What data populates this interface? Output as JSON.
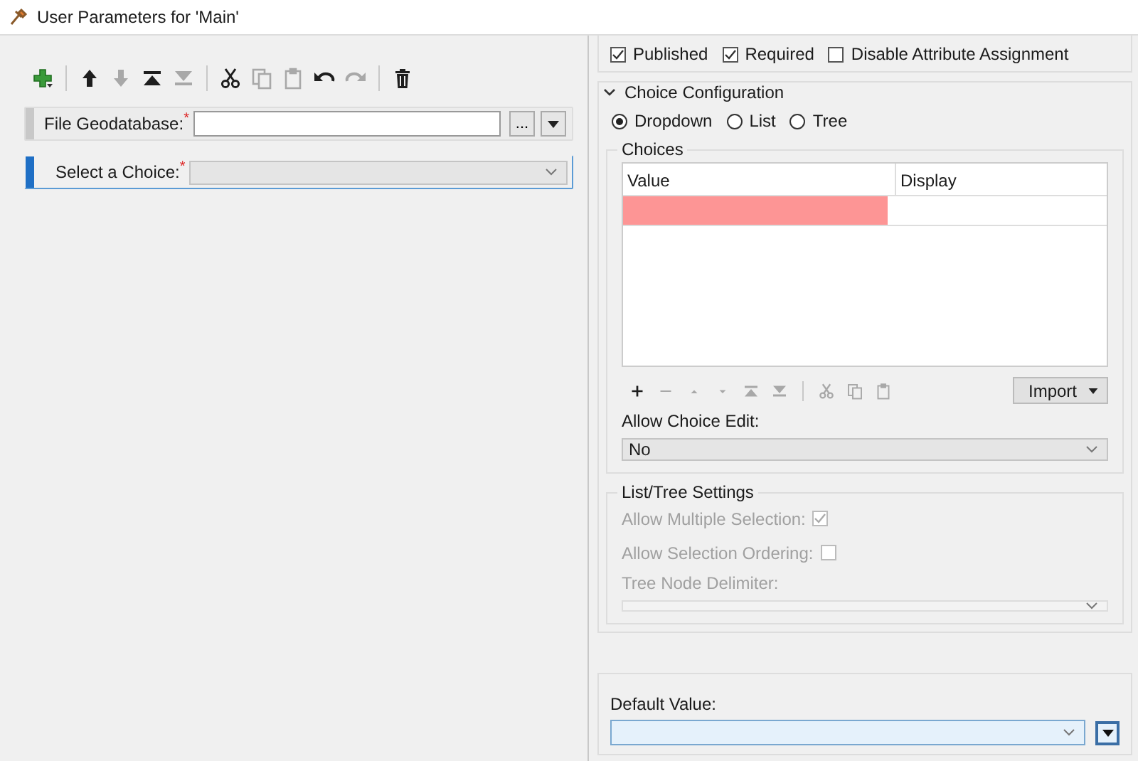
{
  "window": {
    "title": "User Parameters for 'Main'"
  },
  "toolbar": [
    [
      {
        "kind": "add",
        "disabled": false
      }
    ],
    [
      {
        "kind": "up",
        "disabled": false
      },
      {
        "kind": "down",
        "disabled": true
      },
      {
        "kind": "top",
        "disabled": false
      },
      {
        "kind": "bottom",
        "disabled": true
      }
    ],
    [
      {
        "kind": "cut",
        "disabled": false
      },
      {
        "kind": "copy",
        "disabled": true
      },
      {
        "kind": "paste",
        "disabled": true
      },
      {
        "kind": "undo",
        "disabled": false
      },
      {
        "kind": "redo",
        "disabled": true
      }
    ],
    [
      {
        "kind": "delete",
        "disabled": false
      }
    ]
  ],
  "parameters": [
    {
      "kind": "file",
      "label": "File Geodatabase:",
      "marker": "*",
      "selected": false,
      "browse": "..."
    },
    {
      "kind": "choice",
      "label": "Select a Choice:",
      "marker": "*",
      "selected": true
    }
  ],
  "flags": [
    {
      "label": "Published",
      "checked": true
    },
    {
      "label": "Required",
      "checked": true
    },
    {
      "label": "Disable Attribute Assignment",
      "checked": false
    }
  ],
  "choice_configuration": {
    "title": "Choice Configuration",
    "expanded": true,
    "types": [
      {
        "label": "Dropdown",
        "selected": true
      },
      {
        "label": "List",
        "selected": false
      },
      {
        "label": "Tree",
        "selected": false
      }
    ],
    "choices": {
      "title": "Choices",
      "columns": [
        "Value",
        "Display"
      ],
      "rows": [
        {
          "invalid": true
        }
      ],
      "toolbar": [
        [
          {
            "kind": "add",
            "disabled": false
          },
          {
            "kind": "remove",
            "disabled": true
          },
          {
            "kind": "up",
            "disabled": true
          },
          {
            "kind": "down",
            "disabled": true
          },
          {
            "kind": "top",
            "disabled": true
          },
          {
            "kind": "bottom",
            "disabled": true
          }
        ],
        [
          {
            "kind": "cut",
            "disabled": true
          },
          {
            "kind": "copy",
            "disabled": true
          },
          {
            "kind": "paste",
            "disabled": true
          }
        ]
      ],
      "import_button": "Import",
      "allow_edit": {
        "label": "Allow Choice Edit:",
        "value": "No"
      }
    },
    "list_tree_settings": {
      "title": "List/Tree Settings",
      "disabled": true,
      "options": [
        {
          "label": "Allow Multiple Selection:",
          "checked": true
        },
        {
          "label": "Allow Selection Ordering:",
          "checked": false
        }
      ],
      "delimiter": {
        "label": "Tree Node Delimiter:"
      }
    }
  },
  "default_value": {
    "label": "Default Value:"
  }
}
